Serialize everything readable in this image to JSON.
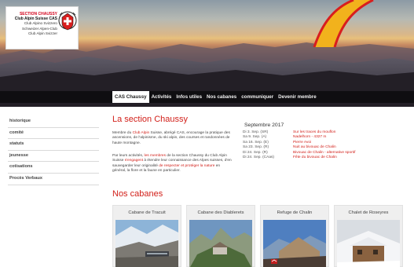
{
  "logo": {
    "section": "SECTION CHAUSSY",
    "club": "Club Alpin Suisse CAS",
    "line3": "Club Alpino Svizzero",
    "line4": "Schweizer Alpen-Club",
    "line5": "Club Alpin Svizzer"
  },
  "nav": {
    "items": [
      {
        "label": "CAS Chaussy",
        "active": true
      },
      {
        "label": "Activités"
      },
      {
        "label": "Infos utiles"
      },
      {
        "label": "Nos cabanes"
      },
      {
        "label": "communiquer"
      },
      {
        "label": "Devenir membre"
      }
    ]
  },
  "sidebar": {
    "items": [
      {
        "label": "historique"
      },
      {
        "label": "comité"
      },
      {
        "label": "statuts"
      },
      {
        "label": "jeunesse"
      },
      {
        "label": "cotisations"
      },
      {
        "label": "Procès Verbaux"
      }
    ]
  },
  "main": {
    "title": "La section Chaussy",
    "p1": {
      "t1": "Membre du ",
      "link1": "Club Alpin",
      "t2": " Suisse, abrégé CAS, encourage la pratique des ascensions, de l'alpinisme, du ski alpin, des courses et randonnées de haute montagne."
    },
    "p2": {
      "t1": "Par leurs activités, ",
      "link1": "les membres",
      "t2": " de la section Chaussy du Club Alpin Suisse ",
      "link2": "s'engagent",
      "t3": " à étendre leur connaissance des Alpes suisses, d'en sauvegarder leur originalité ",
      "link3": "de respecter et protéger la nature",
      "t4": " en général, la flore et la faune en particulier."
    }
  },
  "agenda": {
    "title": "Septembre 2017",
    "rows": [
      {
        "date": "Di 3. Sep. (SR)",
        "event": "Sur les traces du mouflon"
      },
      {
        "date": "Sa 9. Sep. (A)",
        "event": "Nadelhorn - 4327 m"
      },
      {
        "date": "Sa 16. Sep. (E)",
        "event": "Pierre Avoi"
      },
      {
        "date": "Sa 23. Sep. (R)",
        "event": "Nuit au bivouac de Chalin"
      },
      {
        "date": "Di 24. Sep. (R)",
        "event": "Bivouac de Chalin - alternative sportif"
      },
      {
        "date": "Di 24. Sep. (CAas)",
        "event": "Fête du bivouac de Chalin"
      }
    ]
  },
  "cabanes": {
    "title": "Nos cabanes",
    "cards": [
      {
        "label": "Cabane de Tracuit"
      },
      {
        "label": "Cabane des Diablerets"
      },
      {
        "label": "Refuge de Chalin"
      },
      {
        "label": "Chalet de Roseyres"
      }
    ]
  },
  "colors": {
    "accent": "#d2201a",
    "nav_bg": "#2b2b2b",
    "sidebar_border": "#d9d9d9"
  }
}
